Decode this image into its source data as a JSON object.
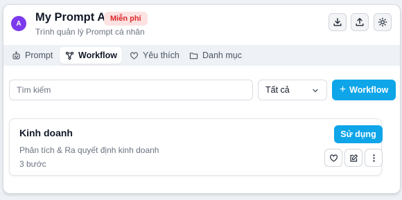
{
  "header": {
    "avatar_letter": "A",
    "app_title": "My Prompt AI",
    "badge": "Miễn phí",
    "subtitle": "Trình quản lý Prompt cá nhân",
    "actions": [
      "download-icon",
      "upload-icon",
      "sun-icon"
    ]
  },
  "tabs": [
    {
      "label": "Prompt",
      "icon": "robot-icon",
      "active": false
    },
    {
      "label": "Workflow",
      "icon": "workflow-icon",
      "active": true
    },
    {
      "label": "Yêu thích",
      "icon": "heart-icon",
      "active": false
    },
    {
      "label": "Danh mục",
      "icon": "folder-icon",
      "active": false
    }
  ],
  "toolbar": {
    "search_placeholder": "Tìm kiếm",
    "filter_value": "Tất cả",
    "add_label": "Workflow",
    "add_prefix": "+"
  },
  "workflows": [
    {
      "title": "Kinh doanh",
      "description": "Phân tích & Ra quyết định kinh doanh",
      "steps": "3 bước",
      "use_label": "Sử dụng"
    }
  ],
  "colors": {
    "accent": "#0ea5e9",
    "avatar": "#7c3aed",
    "badge_bg": "#fde2e2",
    "badge_text": "#dc2626"
  }
}
